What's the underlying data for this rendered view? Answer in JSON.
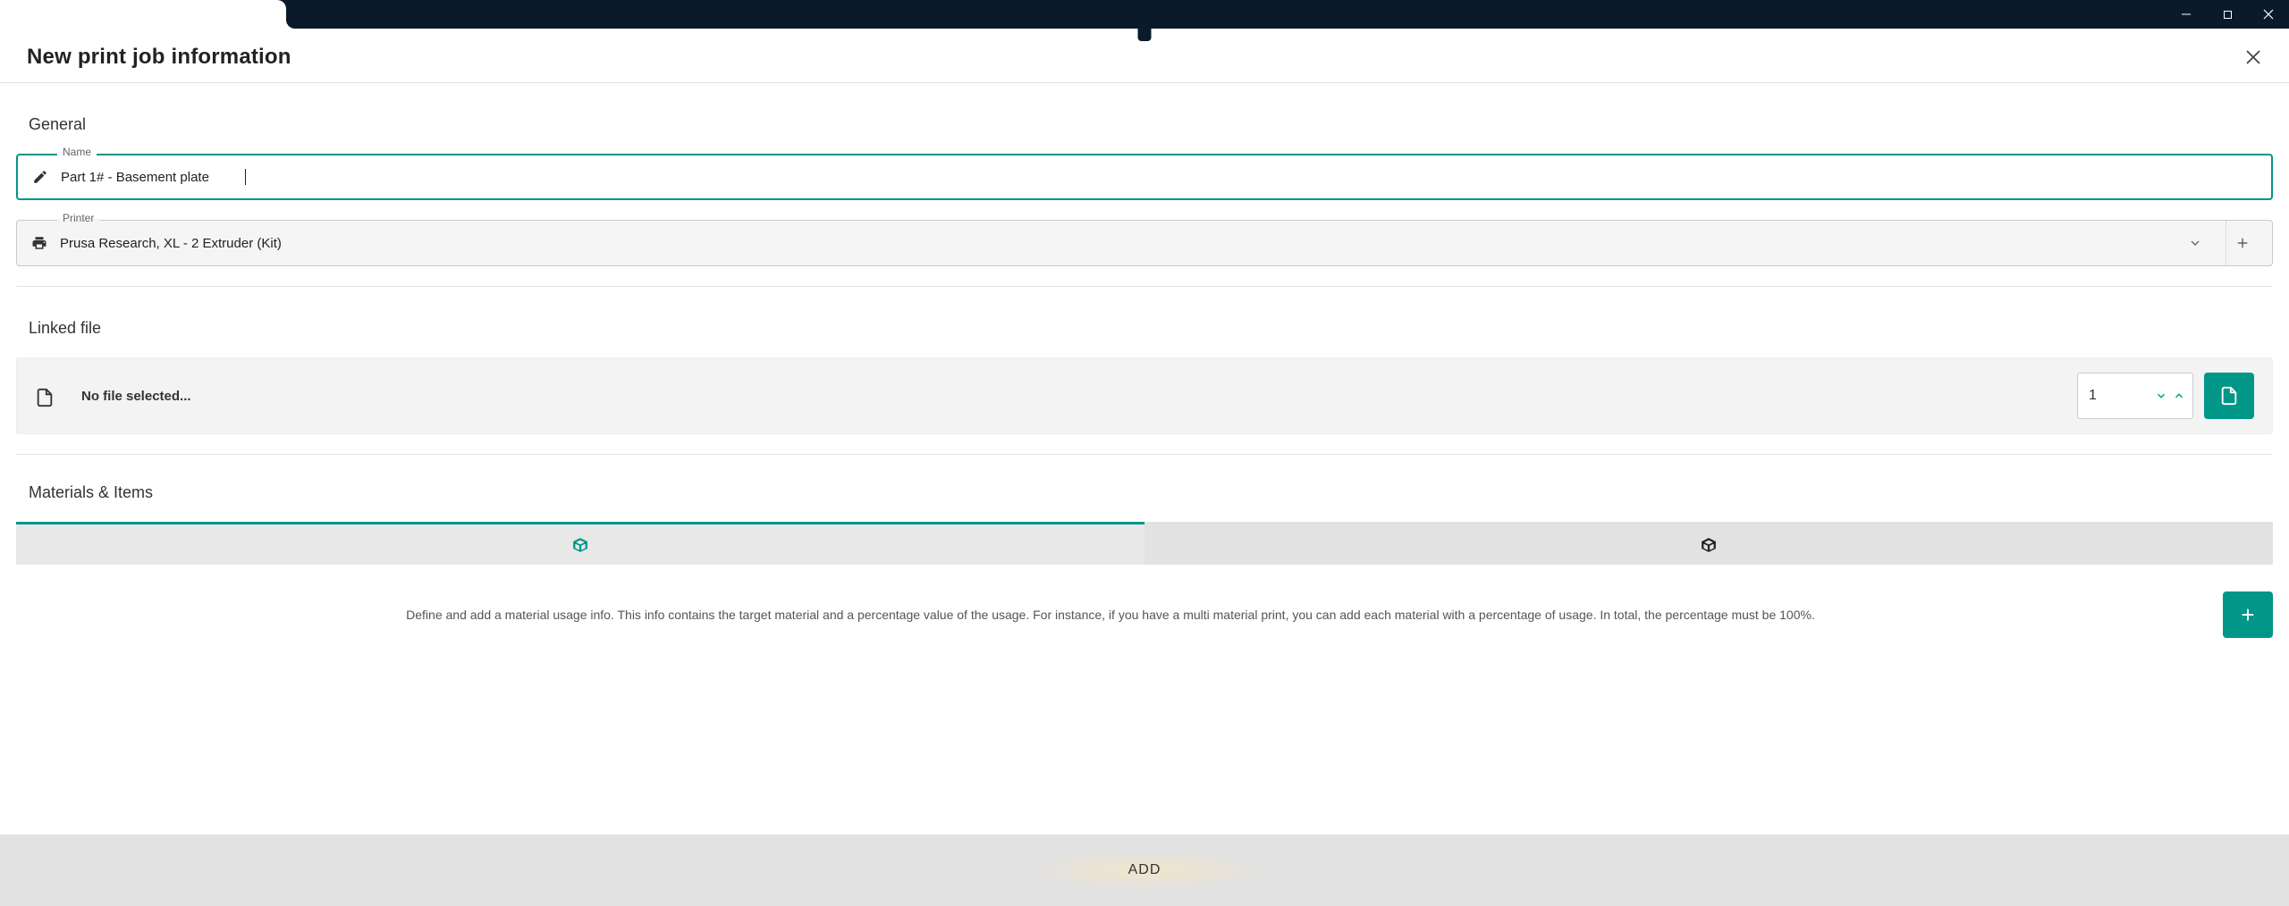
{
  "window": {
    "minimize": "−",
    "maximize": "☐",
    "close": "×"
  },
  "header": {
    "title": "New print job information"
  },
  "general": {
    "heading": "General",
    "name_label": "Name",
    "name_value": "Part 1# - Basement plate",
    "printer_label": "Printer",
    "printer_value": "Prusa Research, XL - 2 Extruder (Kit)"
  },
  "linked_file": {
    "heading": "Linked file",
    "empty_text": "No file selected...",
    "count": "1"
  },
  "materials": {
    "heading": "Materials & Items",
    "helper": "Define and add a material usage info. This info contains the target material and a percentage value of the usage. For instance, if you have a multi material print, you can add each material with a percentage of usage. In total, the percentage must be 100%.",
    "add_label": "+"
  },
  "footer": {
    "add": "ADD"
  },
  "colors": {
    "accent": "#009688"
  }
}
